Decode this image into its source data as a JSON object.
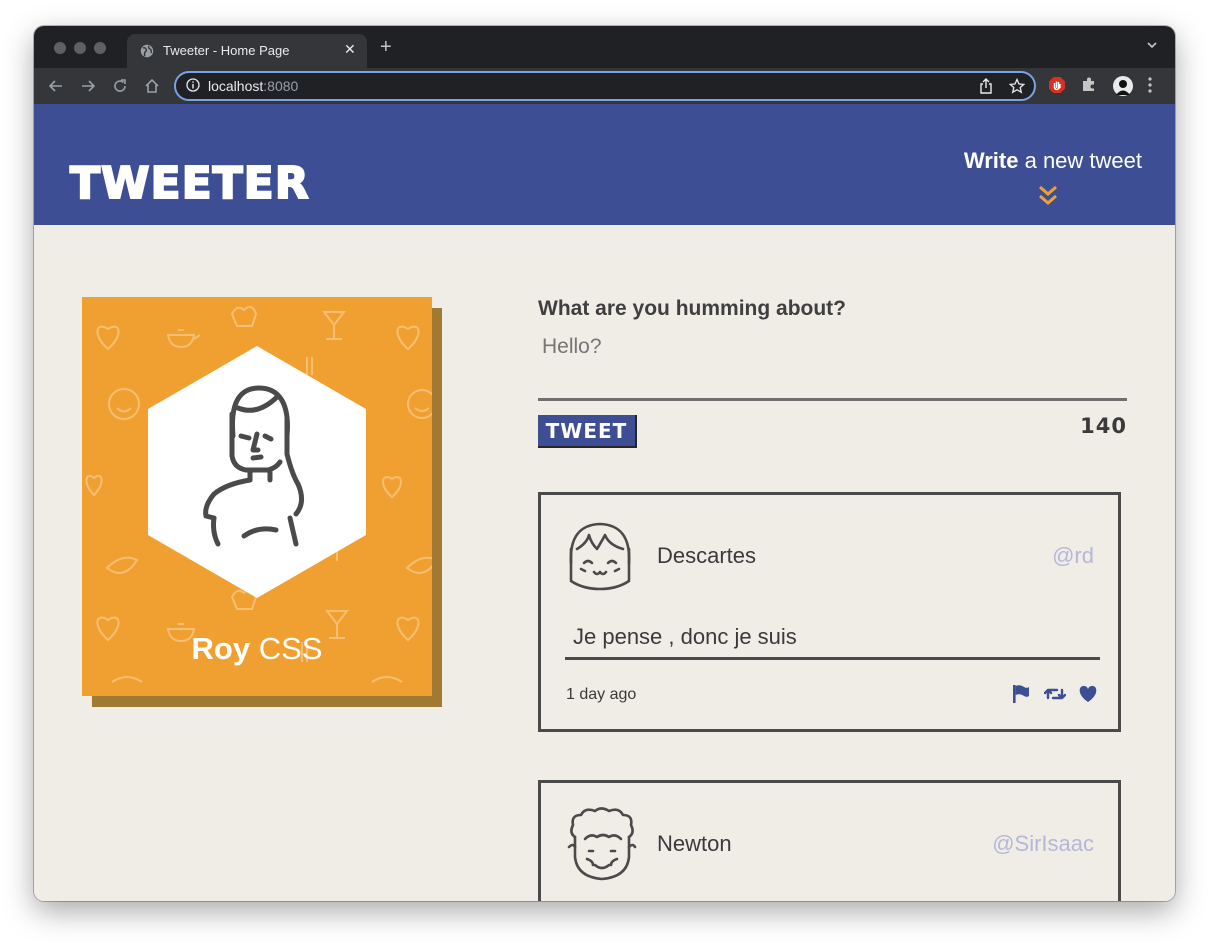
{
  "browser": {
    "tab_title": "Tweeter - Home Page",
    "url_host": "localhost",
    "url_port": ":8080",
    "icons": [
      "globe-icon",
      "close-icon",
      "plus-icon",
      "chevron-down-icon",
      "back-arrow-icon",
      "forward-arrow-icon",
      "reload-icon",
      "home-icon",
      "info-icon",
      "share-icon",
      "bookmark-star-icon",
      "adblock-icon",
      "extensions-puzzle-icon",
      "profile-avatar-icon",
      "kebab-menu-icon"
    ]
  },
  "header": {
    "logo": "TWEETER",
    "compose_bold": "Write",
    "compose_rest": " a new tweet",
    "bg_color": "#3e4e94",
    "accent_color": "#f0a030"
  },
  "profile": {
    "first_name": "Roy",
    "last_name": " CSS",
    "card_color": "#f0a030"
  },
  "composer": {
    "label": "What are you humming about?",
    "placeholder": "Hello?",
    "button_label": "TWEET",
    "counter": "140"
  },
  "tweets": [
    {
      "name": "Descartes",
      "handle": "@rd",
      "content": "Je pense , donc je suis",
      "time": "1 day ago",
      "actions": [
        "flag-icon",
        "retweet-icon",
        "heart-icon"
      ]
    },
    {
      "name": "Newton",
      "handle": "@SirIsaac"
    }
  ]
}
